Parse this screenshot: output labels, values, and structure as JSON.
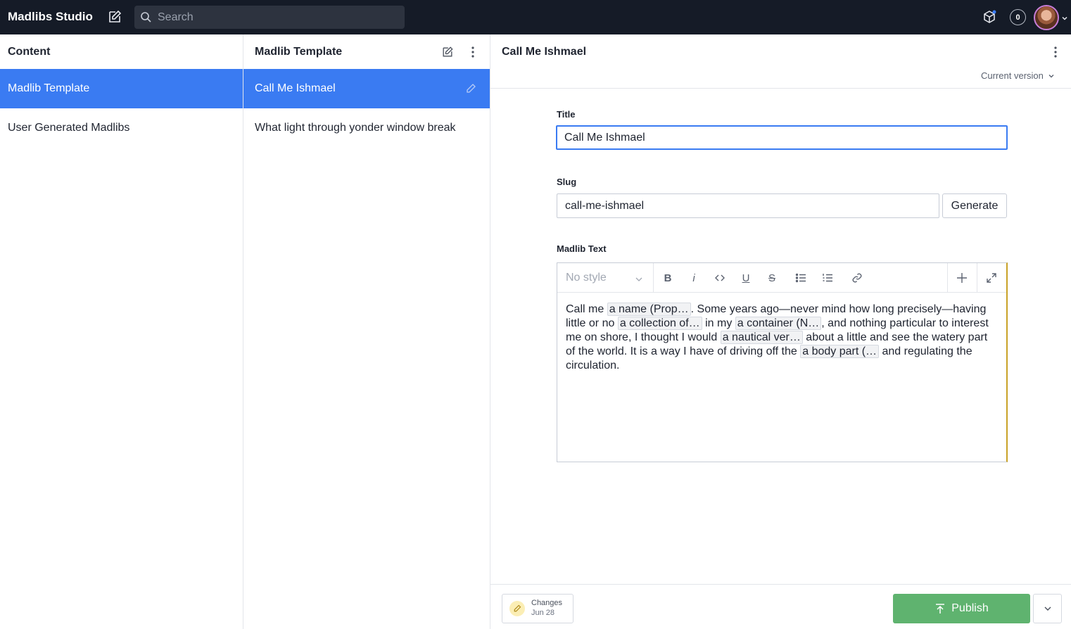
{
  "topbar": {
    "brand": "Madlibs Studio",
    "search_placeholder": "Search",
    "notification_count": "0"
  },
  "pane_content": {
    "title": "Content",
    "items": [
      {
        "label": "Madlib Template",
        "active": true
      },
      {
        "label": "User Generated Madlibs",
        "active": false
      }
    ]
  },
  "pane_list": {
    "title": "Madlib Template",
    "items": [
      {
        "label": "Call Me Ishmael",
        "active": true
      },
      {
        "label": "What light through yonder window break",
        "active": false
      }
    ]
  },
  "document": {
    "title": "Call Me Ishmael",
    "version_label": "Current version",
    "fields": {
      "title_label": "Title",
      "title_value": "Call Me Ishmael",
      "slug_label": "Slug",
      "slug_value": "call-me-ishmael",
      "generate_label": "Generate",
      "text_label": "Madlib Text",
      "style_placeholder": "No style"
    },
    "madlib": {
      "t0": "Call me ",
      "c0": "a name (Prop…",
      "t1": ". Some years ago—never mind how long precisely—having little or no ",
      "c1": "a collection of…",
      "t2": " in my ",
      "c2": "a container (N…",
      "t3": ", and nothing particular to interest me on shore, I thought I would ",
      "c3": "a nautical ver…",
      "t4": " about a little and see the watery part of the world. It is a way I have of driving off the ",
      "c4": "a body part (…",
      "t5": " and regulating the circulation."
    }
  },
  "footer": {
    "changes_label": "Changes",
    "changes_date": "Jun 28",
    "publish_label": "Publish"
  },
  "colors": {
    "topbar_bg": "#151b27",
    "selection": "#3a7bf2",
    "publish": "#5fb36f"
  }
}
